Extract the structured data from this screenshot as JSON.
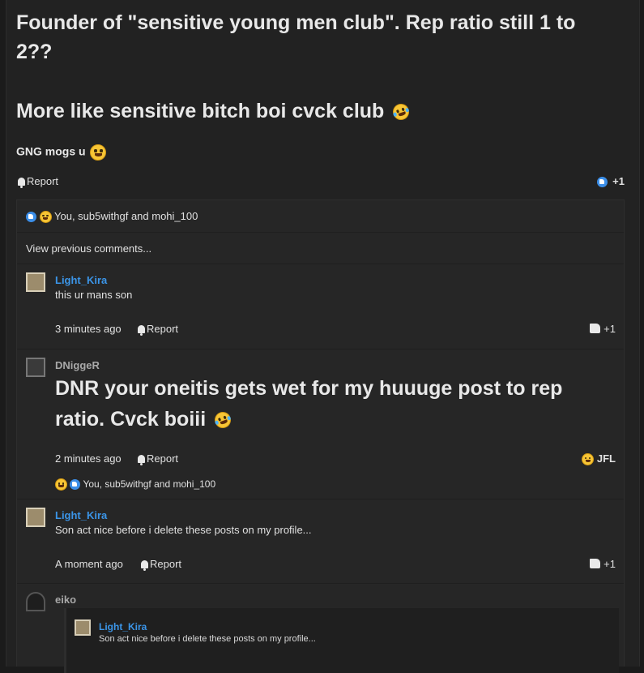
{
  "post": {
    "title_line1": "Founder of \"sensitive young men club\". Rep ratio still 1 to",
    "title_line2": "2??",
    "line3": "More like sensitive bitch boi cvck club",
    "line4": "GNG mogs u",
    "report_label": "Report",
    "reaction_count": "+1",
    "reactions_summary": "You, sub5withgf and mohi_100",
    "view_previous": "View previous comments..."
  },
  "comments": [
    {
      "author": "Light_Kira",
      "text": "this ur mans son",
      "time": "3 minutes ago",
      "report": "Report",
      "score": "+1"
    },
    {
      "author": "DNiggeR",
      "line1": "DNR your oneitis gets wet for my huuuge post to rep",
      "line2": "ratio. Cvck boiii",
      "time": "2 minutes ago",
      "report": "Report",
      "reaction": "JFL",
      "reactions_summary": "You, sub5withgf and mohi_100"
    },
    {
      "author": "Light_Kira",
      "text": "Son act nice before i delete these posts on my profile...",
      "time": "A moment ago",
      "report": "Report",
      "score": "+1"
    },
    {
      "author": "eiko",
      "quote_author": "Light_Kira",
      "quote_text": "Son act nice before i delete these posts on my profile..."
    }
  ],
  "colors": {
    "accent": "#3b95e8",
    "background": "#222222"
  }
}
